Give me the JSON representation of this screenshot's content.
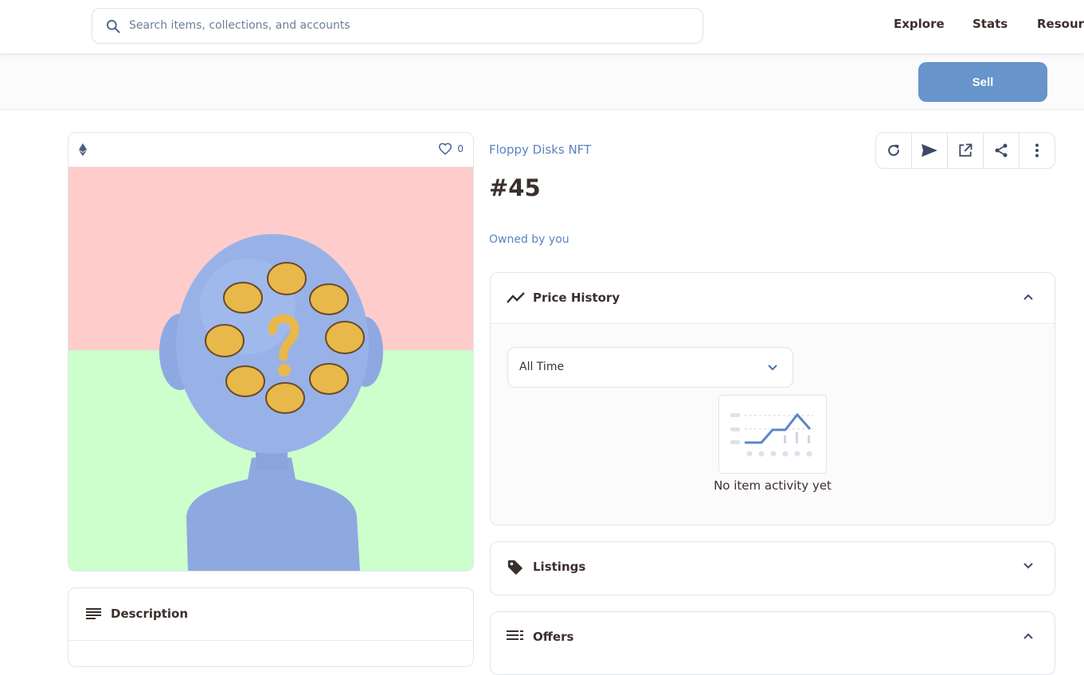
{
  "header": {
    "search_placeholder": "Search items, collections, and accounts",
    "nav": [
      "Explore",
      "Stats",
      "Resour"
    ]
  },
  "toolbar": {
    "sell_label": "Sell"
  },
  "item": {
    "collection": "Floppy Disks NFT",
    "title": "#45",
    "owner_text": "Owned by you",
    "favorites": "0",
    "art_colors": {
      "top": "#ffcccc",
      "bottom": "#ccffcc",
      "head": "#98b2e8"
    }
  },
  "actions": [
    "refresh-icon",
    "transfer-icon",
    "open-external-icon",
    "share-icon",
    "more-icon"
  ],
  "price_history": {
    "label": "Price History",
    "filter_value": "All Time",
    "empty_text": "No item activity yet"
  },
  "listings": {
    "label": "Listings"
  },
  "offers": {
    "label": "Offers"
  },
  "description": {
    "label": "Description"
  },
  "colors": {
    "accent": "#6694cb",
    "link": "#5b83c0",
    "text": "#3b2f2d"
  }
}
